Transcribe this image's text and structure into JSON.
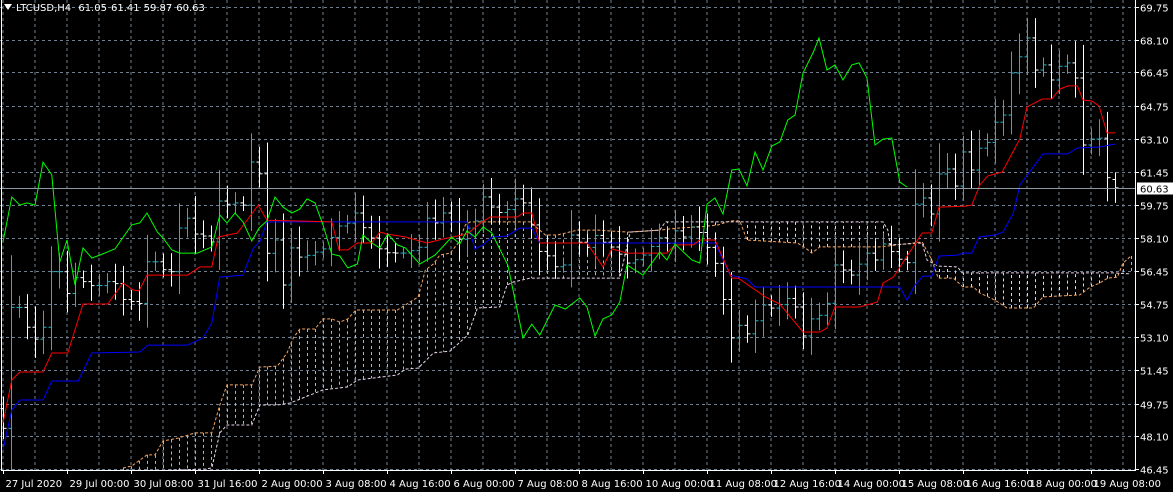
{
  "header": {
    "symbol_timeframe": "LTCUSD,H4",
    "open": "61.05",
    "high": "61.41",
    "low": "59.87",
    "close": "60.63"
  },
  "colors": {
    "background": "#000000",
    "grid": "#6f7f8f",
    "frame": "#ffffff",
    "bar_up": "#22b4c4",
    "bar_down": "#ffffff",
    "tenkan": "#ff0000",
    "kijun": "#0000ff",
    "chikou": "#00ff00",
    "span_a": "#f4a460",
    "span_b": "#e8d4e8",
    "price_line": "#8c9aa8"
  },
  "price_axis": {
    "labels": [
      "69.75",
      "68.10",
      "66.45",
      "64.75",
      "63.10",
      "61.45",
      "59.75",
      "58.10",
      "56.45",
      "54.75",
      "53.10",
      "51.45",
      "49.75",
      "48.10",
      "46.45"
    ],
    "current_price_label": "60.63"
  },
  "time_axis": {
    "labels": [
      "27 Jul 2020",
      "29 Jul 00:00",
      "30 Jul 08:00",
      "31 Jul 16:00",
      "2 Aug 00:00",
      "3 Aug 08:00",
      "4 Aug 16:00",
      "6 Aug 00:00",
      "7 Aug 08:00",
      "8 Aug 16:00",
      "10 Aug 00:00",
      "11 Aug 08:00",
      "12 Aug 16:00",
      "14 Aug 00:00",
      "15 Aug 08:00",
      "16 Aug 16:00",
      "18 Aug 00:00",
      "19 Aug 08:00"
    ],
    "bars_per_label": 8
  },
  "chart_data": {
    "type": "ohlc",
    "title": "LTCUSD,H4",
    "ylim": [
      46.45,
      69.75
    ],
    "bar_count": 140,
    "current_price": 60.63,
    "chikou_shift": 26,
    "last_bar": {
      "open": 61.05,
      "high": 61.41,
      "low": 59.87,
      "close": 60.63
    },
    "early_closes": [
      48.5,
      54.6,
      54.6,
      53.6,
      53.0,
      53.6,
      56.4,
      56.4,
      55.3,
      56.1,
      55.9,
      55.7,
      55.7,
      55.9,
      55.8,
      55.0,
      54.9,
      54.8,
      56.9,
      56.9,
      56.5,
      56.4,
      58.6,
      59.1,
      58.3,
      58.2
    ],
    "tenkan": [
      [
        0,
        48.77
      ],
      [
        1.1,
        50.94
      ],
      [
        2.1,
        51.34
      ],
      [
        5,
        51.34
      ],
      [
        6.1,
        52.3
      ],
      [
        8.1,
        52.3
      ],
      [
        10,
        54.77
      ],
      [
        13.1,
        54.77
      ],
      [
        15,
        55.83
      ],
      [
        16.3,
        55.48
      ],
      [
        17,
        55.43
      ],
      [
        18,
        56.23
      ],
      [
        23.1,
        56.23
      ],
      [
        24.6,
        56.64
      ],
      [
        26.1,
        56.64
      ],
      [
        26.9,
        58.15
      ],
      [
        29.3,
        58.35
      ],
      [
        30.9,
        59.21
      ],
      [
        31.9,
        59.76
      ],
      [
        33,
        59.0
      ],
      [
        41.1,
        58.91
      ],
      [
        42,
        57.5
      ],
      [
        43.1,
        57.5
      ],
      [
        44.3,
        57.85
      ],
      [
        46.1,
        57.85
      ],
      [
        47.1,
        58.4
      ],
      [
        48,
        58.3
      ],
      [
        50.3,
        58.15
      ],
      [
        53,
        57.85
      ],
      [
        55,
        58.05
      ],
      [
        58,
        58.3
      ],
      [
        59.9,
        58.91
      ],
      [
        60.9,
        59.16
      ],
      [
        64.3,
        59.16
      ],
      [
        65,
        59.36
      ],
      [
        66.1,
        59.36
      ],
      [
        67.1,
        57.85
      ],
      [
        73,
        57.85
      ],
      [
        75,
        56.64
      ],
      [
        76.1,
        57.55
      ],
      [
        78,
        57.34
      ],
      [
        83,
        57.34
      ],
      [
        84,
        57.75
      ],
      [
        86.3,
        57.75
      ],
      [
        87.1,
        58.0
      ],
      [
        89,
        58.0
      ],
      [
        91.1,
        56.08
      ],
      [
        91.9,
        56.08
      ],
      [
        95.3,
        55.13
      ],
      [
        97.1,
        54.77
      ],
      [
        100,
        53.36
      ],
      [
        102.1,
        53.36
      ],
      [
        103,
        53.56
      ],
      [
        104,
        54.62
      ],
      [
        107.1,
        54.62
      ],
      [
        109.3,
        54.87
      ],
      [
        110,
        55.83
      ],
      [
        111.3,
        56.13
      ],
      [
        114.9,
        58.35
      ],
      [
        116.1,
        58.35
      ],
      [
        117,
        59.66
      ],
      [
        120.3,
        59.71
      ],
      [
        121.1,
        59.76
      ],
      [
        122.1,
        60.77
      ],
      [
        123.1,
        61.23
      ],
      [
        124.9,
        61.43
      ],
      [
        127.1,
        63.09
      ],
      [
        128,
        64.71
      ],
      [
        129.9,
        65.11
      ],
      [
        131.1,
        65.11
      ],
      [
        132.1,
        65.61
      ],
      [
        133.1,
        65.77
      ],
      [
        134.3,
        65.77
      ],
      [
        135,
        65.06
      ],
      [
        136.1,
        65.01
      ],
      [
        137,
        64.76
      ],
      [
        138,
        63.4
      ],
      [
        139,
        63.4
      ]
    ],
    "kijun": [
      [
        0,
        47.41
      ],
      [
        1.1,
        49.43
      ],
      [
        2.1,
        49.93
      ],
      [
        5,
        49.93
      ],
      [
        6.1,
        50.89
      ],
      [
        9.4,
        50.89
      ],
      [
        11.1,
        52.3
      ],
      [
        17.1,
        52.35
      ],
      [
        18.1,
        52.7
      ],
      [
        23.1,
        52.7
      ],
      [
        25,
        53.06
      ],
      [
        26.1,
        53.81
      ],
      [
        27.1,
        56.13
      ],
      [
        30,
        56.23
      ],
      [
        31.3,
        57.6
      ],
      [
        32.1,
        57.9
      ],
      [
        33,
        58.91
      ],
      [
        58,
        58.91
      ],
      [
        59,
        57.55
      ],
      [
        60,
        57.75
      ],
      [
        61.1,
        58.15
      ],
      [
        63,
        58.2
      ],
      [
        64.6,
        58.6
      ],
      [
        66.1,
        58.6
      ],
      [
        67.1,
        57.85
      ],
      [
        89,
        57.85
      ],
      [
        90.9,
        56.23
      ],
      [
        93,
        56.03
      ],
      [
        94,
        55.63
      ],
      [
        112.1,
        55.63
      ],
      [
        113,
        54.97
      ],
      [
        114,
        55.73
      ],
      [
        115,
        56.18
      ],
      [
        116.1,
        56.18
      ],
      [
        117,
        57.19
      ],
      [
        119.3,
        57.24
      ],
      [
        120,
        57.34
      ],
      [
        121.1,
        57.34
      ],
      [
        122,
        58.15
      ],
      [
        124,
        58.25
      ],
      [
        125,
        58.4
      ],
      [
        126.3,
        59.36
      ],
      [
        127.1,
        60.77
      ],
      [
        130,
        62.34
      ],
      [
        133.1,
        62.34
      ],
      [
        134.3,
        62.64
      ],
      [
        137.1,
        62.69
      ],
      [
        139,
        62.84
      ]
    ],
    "chikou": [
      [
        0,
        57.9
      ],
      [
        1.1,
        60.17
      ],
      [
        2.1,
        59.76
      ],
      [
        3,
        59.87
      ],
      [
        4,
        59.76
      ],
      [
        5,
        61.93
      ],
      [
        6.1,
        61.28
      ],
      [
        7.1,
        56.89
      ],
      [
        8,
        58.0
      ],
      [
        9,
        55.73
      ],
      [
        10,
        57.6
      ],
      [
        11.1,
        57.09
      ],
      [
        12.1,
        57.24
      ],
      [
        14,
        57.55
      ],
      [
        16.1,
        58.76
      ],
      [
        17.1,
        58.86
      ],
      [
        18,
        59.36
      ],
      [
        19.3,
        58.4
      ],
      [
        20,
        58.1
      ],
      [
        21.1,
        57.5
      ],
      [
        22.1,
        57.34
      ],
      [
        24.3,
        57.34
      ],
      [
        26.1,
        57.65
      ],
      [
        27.1,
        59.26
      ],
      [
        28,
        58.86
      ],
      [
        29,
        59.36
      ],
      [
        30,
        58.91
      ],
      [
        31.1,
        57.95
      ],
      [
        32,
        58.6
      ],
      [
        33,
        58.96
      ],
      [
        34,
        60.17
      ],
      [
        35,
        59.66
      ],
      [
        36.1,
        59.36
      ],
      [
        37.1,
        59.56
      ],
      [
        38,
        60.07
      ],
      [
        39,
        59.87
      ],
      [
        40,
        58.76
      ],
      [
        41.1,
        57.29
      ],
      [
        42.1,
        57.19
      ],
      [
        43.1,
        56.59
      ],
      [
        44.3,
        56.79
      ],
      [
        45,
        58.25
      ],
      [
        46.1,
        57.85
      ],
      [
        47.1,
        57.6
      ],
      [
        48.1,
        58.3
      ],
      [
        49.3,
        57.75
      ],
      [
        50.3,
        57.6
      ],
      [
        52.1,
        56.79
      ],
      [
        54,
        57.24
      ],
      [
        56.1,
        58.15
      ],
      [
        57.1,
        57.8
      ],
      [
        58,
        58.46
      ],
      [
        59,
        58.15
      ],
      [
        60,
        58.66
      ],
      [
        61.1,
        58.35
      ],
      [
        63.1,
        56.74
      ],
      [
        65,
        53.06
      ],
      [
        66.1,
        53.76
      ],
      [
        67.1,
        53.21
      ],
      [
        69,
        54.72
      ],
      [
        70.3,
        54.52
      ],
      [
        72.1,
        55.08
      ],
      [
        73,
        54.62
      ],
      [
        74,
        53.16
      ],
      [
        75,
        54.02
      ],
      [
        76.1,
        54.22
      ],
      [
        77.1,
        54.87
      ],
      [
        78,
        56.74
      ],
      [
        80,
        56.23
      ],
      [
        82.1,
        57.39
      ],
      [
        83,
        56.99
      ],
      [
        84,
        57.8
      ],
      [
        86.1,
        56.99
      ],
      [
        87.1,
        56.84
      ],
      [
        88,
        59.81
      ],
      [
        89,
        60.12
      ],
      [
        90,
        59.31
      ],
      [
        91.1,
        61.53
      ],
      [
        92,
        61.58
      ],
      [
        93,
        60.72
      ],
      [
        94,
        62.44
      ],
      [
        95,
        61.53
      ],
      [
        96.1,
        62.74
      ],
      [
        97.1,
        62.94
      ],
      [
        98.1,
        64.05
      ],
      [
        99,
        64.3
      ],
      [
        100,
        66.42
      ],
      [
        101.3,
        67.48
      ],
      [
        102,
        68.19
      ],
      [
        103,
        66.57
      ],
      [
        104,
        66.83
      ],
      [
        105,
        66.07
      ],
      [
        106.1,
        66.83
      ],
      [
        107,
        66.93
      ],
      [
        108,
        66.17
      ],
      [
        109,
        62.79
      ],
      [
        110,
        63.09
      ],
      [
        111.1,
        63.14
      ],
      [
        112.1,
        60.92
      ],
      [
        113,
        60.67
      ]
    ],
    "senkou_span_a": [
      [
        15,
        46.5
      ],
      [
        16.1,
        46.6
      ],
      [
        18,
        47.16
      ],
      [
        19,
        47.16
      ],
      [
        20,
        47.86
      ],
      [
        21.9,
        48.01
      ],
      [
        24,
        48.27
      ],
      [
        26.1,
        48.27
      ],
      [
        27.1,
        49.68
      ],
      [
        28,
        50.69
      ],
      [
        31.1,
        50.69
      ],
      [
        32.1,
        51.59
      ],
      [
        34.3,
        51.64
      ],
      [
        35.5,
        52.3
      ],
      [
        36.3,
        53.06
      ],
      [
        37.1,
        53.51
      ],
      [
        39,
        53.51
      ],
      [
        40,
        54.02
      ],
      [
        41.1,
        54.02
      ],
      [
        42.1,
        53.86
      ],
      [
        43.1,
        54.02
      ],
      [
        44.1,
        54.47
      ],
      [
        49.3,
        54.47
      ],
      [
        50.3,
        54.72
      ],
      [
        51.9,
        55.13
      ],
      [
        52.8,
        56.49
      ],
      [
        53.8,
        56.79
      ],
      [
        54.6,
        57.24
      ],
      [
        55.9,
        57.34
      ],
      [
        56.9,
        57.85
      ],
      [
        57.8,
        58.76
      ],
      [
        58.4,
        58.91
      ],
      [
        65.9,
        58.91
      ],
      [
        67.8,
        58.25
      ],
      [
        69.3,
        58.25
      ],
      [
        71.8,
        58.5
      ],
      [
        74.3,
        58.5
      ],
      [
        78.1,
        58.4
      ],
      [
        82.1,
        58.5
      ],
      [
        84.3,
        58.6
      ],
      [
        87.1,
        58.66
      ],
      [
        89.4,
        58.76
      ],
      [
        90.9,
        58.96
      ],
      [
        92.1,
        58.96
      ],
      [
        93,
        58.0
      ],
      [
        99.3,
        57.85
      ],
      [
        100.3,
        57.6
      ],
      [
        101.1,
        57.34
      ],
      [
        102.1,
        57.65
      ],
      [
        109.6,
        57.65
      ],
      [
        114.9,
        57.9
      ],
      [
        116.1,
        56.99
      ],
      [
        116.9,
        56.08
      ],
      [
        118.8,
        56.08
      ],
      [
        120,
        55.63
      ],
      [
        121.3,
        55.63
      ],
      [
        122.1,
        55.33
      ],
      [
        124,
        54.97
      ],
      [
        125.5,
        54.57
      ],
      [
        128.8,
        54.57
      ],
      [
        130,
        55.13
      ],
      [
        134.6,
        55.23
      ],
      [
        135.9,
        55.63
      ],
      [
        137.1,
        55.83
      ],
      [
        138.1,
        56.08
      ],
      [
        139.3,
        56.13
      ],
      [
        140,
        56.84
      ],
      [
        141,
        57.19
      ]
    ],
    "senkou_span_b": [
      [
        15,
        46.3
      ],
      [
        25.3,
        46.45
      ],
      [
        26.1,
        46.5
      ],
      [
        27.1,
        48.27
      ],
      [
        28,
        48.67
      ],
      [
        31.1,
        48.67
      ],
      [
        32.1,
        49.68
      ],
      [
        34.3,
        49.68
      ],
      [
        35.9,
        49.78
      ],
      [
        40,
        50.44
      ],
      [
        43.1,
        50.59
      ],
      [
        44.3,
        50.94
      ],
      [
        49.3,
        51.19
      ],
      [
        50.3,
        51.49
      ],
      [
        51.9,
        51.54
      ],
      [
        53.8,
        52.3
      ],
      [
        55.9,
        52.4
      ],
      [
        58.1,
        53.21
      ],
      [
        59.3,
        54.57
      ],
      [
        62.1,
        54.62
      ],
      [
        63,
        55.73
      ],
      [
        63.8,
        55.88
      ],
      [
        65.9,
        56.08
      ],
      [
        77.1,
        56.08
      ],
      [
        78.4,
        58.4
      ],
      [
        82.1,
        58.5
      ],
      [
        82.8,
        58.91
      ],
      [
        110,
        58.91
      ],
      [
        110.6,
        58.5
      ],
      [
        110.9,
        57.75
      ],
      [
        114.9,
        57.85
      ],
      [
        115.5,
        56.99
      ],
      [
        116.8,
        56.69
      ],
      [
        119.3,
        56.64
      ],
      [
        119.9,
        56.34
      ],
      [
        138.8,
        56.34
      ],
      [
        141,
        56.29
      ]
    ]
  }
}
